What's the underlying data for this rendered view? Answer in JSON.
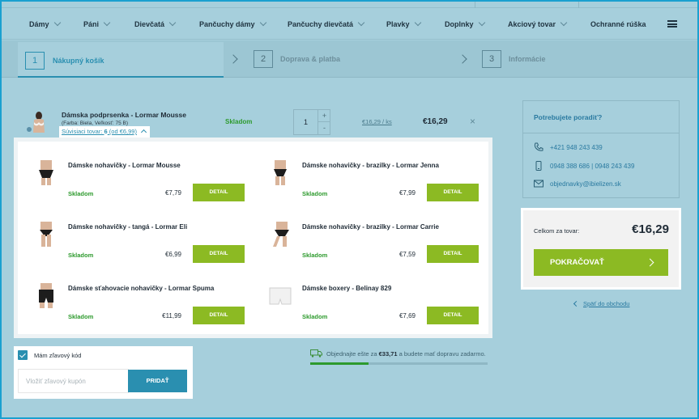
{
  "nav": {
    "items": [
      "Dámy",
      "Páni",
      "Dievčatá",
      "Pančuchy dámy",
      "Pančuchy dievčatá",
      "Plavky",
      "Doplnky",
      "Akciový tovar",
      "Ochranné rúška"
    ]
  },
  "steps": [
    {
      "num": "1",
      "label": "Nákupný košík"
    },
    {
      "num": "2",
      "label": "Doprava & platba"
    },
    {
      "num": "3",
      "label": "Informácie"
    }
  ],
  "cart": {
    "name": "Dámska podprsenka - Lormar Mousse",
    "variant": "(Farba: Biela, Veľkosť: 75 B)",
    "related_prefix": "Súvisiaci tovar: ",
    "related_count": "6",
    "related_from": " (od €6,99)",
    "stock": "Skladom",
    "qty": "1",
    "qty_plus": "+",
    "qty_minus": "-",
    "unit_price": "€16,29 / ks",
    "total": "€16,29",
    "remove": "×"
  },
  "related": [
    {
      "name": "Dámske nohavičky - Lormar Mousse",
      "stock": "Skladom",
      "price": "€7,79",
      "button": "DETAIL"
    },
    {
      "name": "Dámske nohavičky - brazilky - Lormar Jenna",
      "stock": "Skladom",
      "price": "€7,99",
      "button": "DETAIL"
    },
    {
      "name": "Dámske nohavičky - tangá - Lormar Eli",
      "stock": "Skladom",
      "price": "€6,99",
      "button": "DETAIL"
    },
    {
      "name": "Dámske nohavičky - brazilky - Lormar Carrie",
      "stock": "Skladom",
      "price": "€7,59",
      "button": "DETAIL"
    },
    {
      "name": "Dámske sťahovacie nohavičky - Lormar Spuma",
      "stock": "Skladom",
      "price": "€11,99",
      "button": "DETAIL"
    },
    {
      "name": "Dámske boxery - Belinay 829",
      "stock": "Skladom",
      "price": "€7,69",
      "button": "DETAIL"
    }
  ],
  "coupon": {
    "label": "Mám zľavový kód",
    "placeholder": "Vložiť zľavový kupón",
    "button": "PRIDAŤ"
  },
  "shipping": {
    "before": "Objednajte ešte za ",
    "amount": "€33,71",
    "after": " a budete mať dopravu zadarmo.",
    "progress_percent": 33
  },
  "help": {
    "title": "Potrebujete poradiť?",
    "phone": "+421 948 243 439",
    "mobile": "0948 388 686 | 0948 243 439",
    "email": "objednavky@ibielizen.sk"
  },
  "summary": {
    "label": "Celkom za tovar:",
    "total": "€16,29",
    "continue": "POKRAČOVAŤ",
    "back": "Späť do obchodu"
  },
  "colors": {
    "accent_blue": "#2a8fb0",
    "accent_green": "#8cba23",
    "stock_green": "#2d9a2d"
  }
}
